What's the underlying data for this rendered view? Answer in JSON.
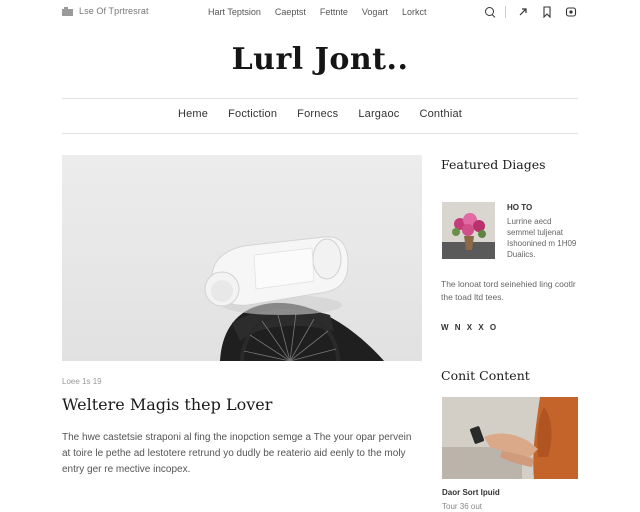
{
  "topbar": {
    "left_text": "Lse Of Tprtresrat",
    "links": [
      "Hart Teptsion",
      "Caeptst",
      "Fettnte",
      "Vogart",
      "Lorkct"
    ],
    "icons": [
      "search-icon",
      "share-icon",
      "bookmark-icon",
      "account-icon"
    ]
  },
  "site": {
    "logo": "Lurl Jont.."
  },
  "nav": {
    "items": [
      "Heme",
      "Foctiction",
      "Fornecs",
      "Largaoc",
      "Conthiat"
    ]
  },
  "article": {
    "meta": "Loee 1s 19",
    "title": "Weltere Magis thep Lover",
    "excerpt": "The hwe castetsie straponi al fing the inopction semge a The your opar pervein at toire le pethe ad lestotere retrund yo dudly be reaterio aid eenly to the moly entry ger re mective incopex."
  },
  "sidebar": {
    "featured_heading": "Featured Diages",
    "featured": {
      "title": "HO TO",
      "text": "Lurrine aecd semmel tuljenat Ishoonined m 1H09 Duaiics."
    },
    "paragraph": "The lonoat tord seinehied ling cootlr the toad ltd tees.",
    "dots": "W N X X O",
    "content_heading": "Conit Content",
    "content_caption": "Daor Sort Ipuid",
    "content_sub": "Tour 36 out"
  },
  "colors": {
    "text": "#1a1a1a",
    "muted": "#666666",
    "rule": "#e2e2e2",
    "accent": "#c4632a"
  }
}
